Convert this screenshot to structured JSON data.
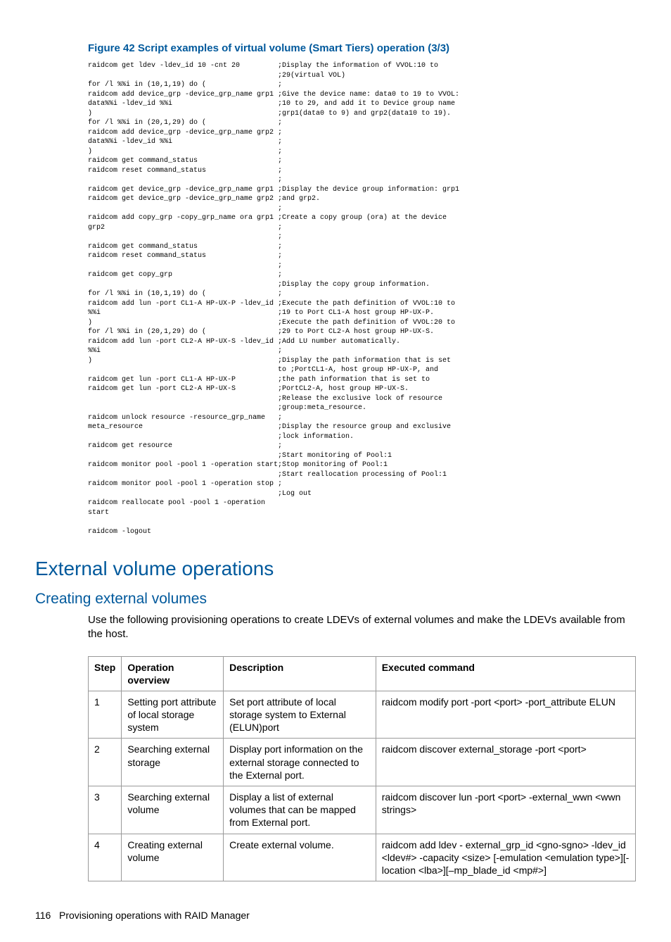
{
  "figure_title": "Figure 42 Script examples of virtual volume (Smart Tiers) operation (3/3)",
  "code_left": "raidcom get ldev -ldev_id 10 -cnt 20\n\nfor /l %%i in (10,1,19) do (\nraidcom add device_grp -device_grp_name grp1\ndata%%i -ldev_id %%i\n)\nfor /l %%i in (20,1,29) do (\nraidcom add device_grp -device_grp_name grp2\ndata%%i -ldev_id %%i\n)\nraidcom get command_status\nraidcom reset command_status\n\nraidcom get device_grp -device_grp_name grp1\nraidcom get device_grp -device_grp_name grp2\n\nraidcom add copy_grp -copy_grp_name ora grp1\ngrp2\n\nraidcom get command_status\nraidcom reset command_status\n\nraidcom get copy_grp\n\nfor /l %%i in (10,1,19) do (\nraidcom add lun -port CL1-A HP-UX-P -ldev_id\n%%i\n)\nfor /l %%i in (20,1,29) do (\nraidcom add lun -port CL2-A HP-UX-S -ldev_id\n%%i\n)\n\nraidcom get lun -port CL1-A HP-UX-P\nraidcom get lun -port CL2-A HP-UX-S\n\n\nraidcom unlock resource -resource_grp_name\nmeta_resource\n\nraidcom get resource\n\nraidcom monitor pool -pool 1 -operation start\n\nraidcom monitor pool -pool 1 -operation stop\n\nraidcom reallocate pool -pool 1 -operation\nstart\n\nraidcom -logout",
  "code_right": ";Display the information of VVOL:10 to\n;29(virtual VOL)\n;\n;Give the device name: data0 to 19 to VVOL:\n;10 to 29, and add it to Device group name\n;grp1(data0 to 9) and grp2(data10 to 19).\n;\n;\n;\n;\n;\n;\n;\n;Display the device group information: grp1\n;and grp2.\n;\n;Create a copy group (ora) at the device\n;\n;\n;\n;\n;\n;\n;Display the copy group information.\n;\n;Execute the path definition of VVOL:10 to\n;19 to Port CL1-A host group HP-UX-P.\n;Execute the path definition of VVOL:20 to\n;29 to Port CL2-A host group HP-UX-S.\n;Add LU number automatically.\n;\n;Display the path information that is set\nto ;PortCL1-A, host group HP-UX-P, and\n;the path information that is set to\n;PortCL2-A, host group HP-UX-S.\n;Release the exclusive lock of resource\n;group:meta_resource.\n;\n;Display the resource group and exclusive\n;lock information.\n;\n;Start monitoring of Pool:1\n;Stop monitoring of Pool:1\n;Start reallocation processing of Pool:1\n;\n;Log out",
  "h1": "External volume operations",
  "h2": "Creating external volumes",
  "body": "Use the following provisioning operations to create LDEVs of external volumes and make the LDEVs available from the host.",
  "table": {
    "headers": [
      "Step",
      "Operation overview",
      "Description",
      "Executed command"
    ],
    "rows": [
      {
        "step": "1",
        "overview": "Setting port attribute of local storage system",
        "desc": "Set port attribute of local storage system to External (ELUN)port",
        "cmd": "raidcom modify port -port <port> -port_attribute ELUN"
      },
      {
        "step": "2",
        "overview": "Searching external storage",
        "desc": "Display port information on the external storage connected to the External port.",
        "cmd": "raidcom discover external_storage -port <port>"
      },
      {
        "step": "3",
        "overview": "Searching external volume",
        "desc": "Display a list of external volumes that can be mapped from External port.",
        "cmd": "raidcom discover lun -port <port> -external_wwn <wwn strings>"
      },
      {
        "step": "4",
        "overview": "Creating external volume",
        "desc": "Create external volume.",
        "cmd": "raidcom add ldev - external_grp_id <gno-sgno> -ldev_id <ldev#> -capacity <size> [-emulation <emulation type>][-location <lba>][–mp_blade_id <mp#>]"
      }
    ]
  },
  "footer_page": "116",
  "footer_text": "Provisioning operations with RAID Manager"
}
